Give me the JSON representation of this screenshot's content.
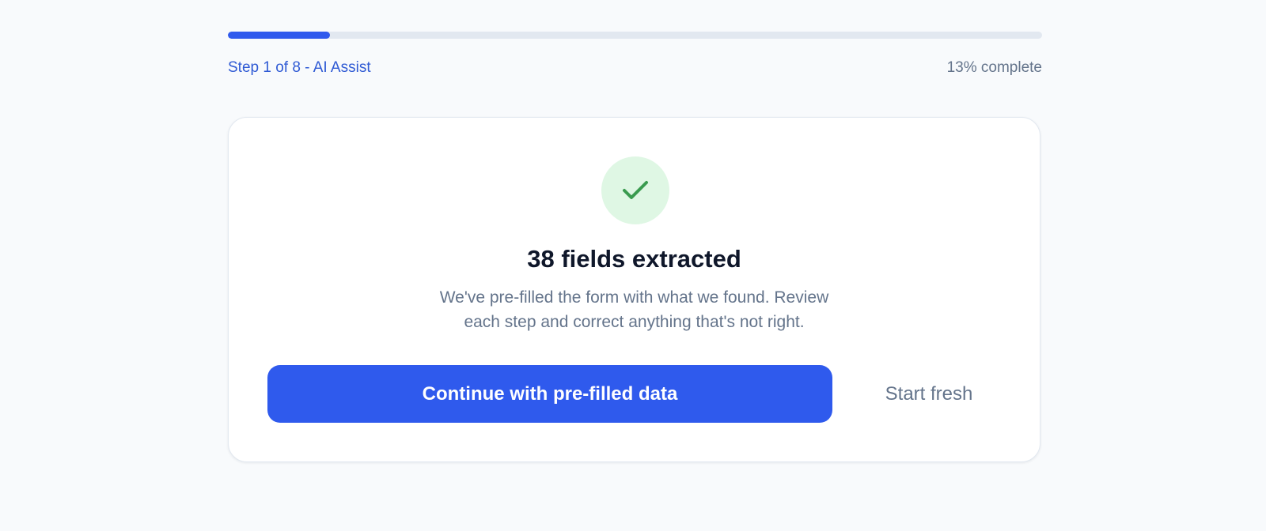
{
  "progress": {
    "fraction": 0.125,
    "step_label": "Step 1 of 8 - AI Assist",
    "percent_label": "13% complete"
  },
  "card": {
    "icon": "check-icon",
    "title": "38 fields extracted",
    "description_lines": [
      "We've pre-filled the form with what we found. Review",
      "each step and correct anything that's not right."
    ],
    "primary_button_label": "Continue with pre-filled data",
    "secondary_button_label": "Start fresh"
  },
  "colors": {
    "accent": "#2f5aed",
    "success": "#3a9b4f",
    "success_bg": "#dff7e4"
  }
}
